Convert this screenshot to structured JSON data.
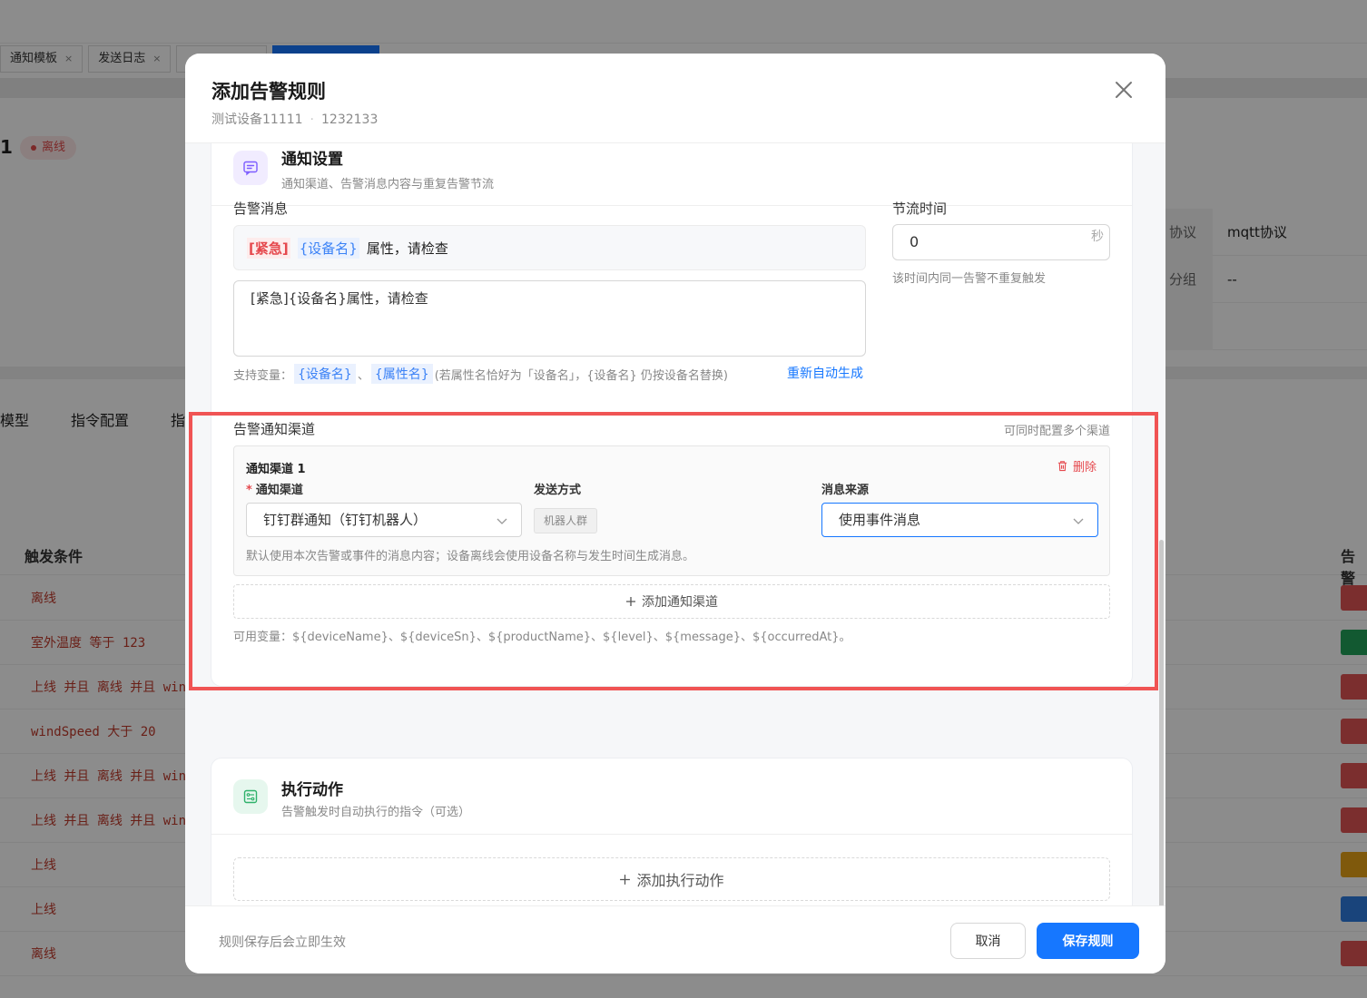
{
  "background": {
    "tabs": [
      {
        "label": "通知模板"
      },
      {
        "label": "发送日志"
      },
      {
        "label": ""
      },
      {
        "label": ""
      }
    ],
    "device_title": "1",
    "status": "离线",
    "info": [
      {
        "key": "协议",
        "value": "mqtt协议"
      },
      {
        "key": "分组",
        "value": "--"
      }
    ],
    "subtabs": [
      "模型",
      "指令配置",
      "指"
    ],
    "table": {
      "col_condition": "触发条件",
      "col_level": "告警",
      "rows": [
        {
          "condition": "离线",
          "level_color": "#e05555"
        },
        {
          "condition": "室外温度 等于 123",
          "level_color": "#22a35a"
        },
        {
          "condition": "上线 并且 离线 并且 wind",
          "level_color": "#e05555"
        },
        {
          "condition": "windSpeed 大于 20",
          "level_color": "#e05555"
        },
        {
          "condition": "上线 并且 离线 并且 wind",
          "level_color": "#e05555"
        },
        {
          "condition": "上线 并且 离线 并且 wind",
          "level_color": "#e05555"
        },
        {
          "condition": "上线",
          "level_color": "#e8a317"
        },
        {
          "condition": "上线",
          "level_color": "#2f7de1"
        },
        {
          "condition": "离线",
          "level_color": "#e05555"
        }
      ]
    }
  },
  "modal": {
    "title": "添加告警规则",
    "device_name": "测试设备11111",
    "device_sn": "1232133",
    "close_icon": "close-icon",
    "notify": {
      "title": "通知设置",
      "desc": "通知渠道、告警消息内容与重复告警节流",
      "icon": "message-icon",
      "message_label": "告警消息",
      "preview": {
        "urgent": "[紧急]",
        "var": "{设备名}",
        "rest": "属性，请检查"
      },
      "message_value": "[紧急]{设备名}属性，请检查",
      "vars_prefix": "支持变量：",
      "var_device": "{设备名}",
      "var_sep": "、",
      "var_attr": "{属性名}",
      "vars_note": "(若属性名恰好为「设备名」，{设备名} 仍按设备名替换)",
      "regen_link": "重新自动生成",
      "throttle_label": "节流时间",
      "throttle_value": "0",
      "throttle_unit": "秒",
      "throttle_help": "该时间内同一告警不重复触发",
      "channels_label": "告警通知渠道",
      "channels_hint": "可同时配置多个渠道",
      "channel": {
        "title": "通知渠道 1",
        "delete_label": "删除",
        "channel_label": "通知渠道",
        "channel_value": "钉钉群通知（钉钉机器人）",
        "method_label": "发送方式",
        "method_value": "机器人群",
        "source_label": "消息来源",
        "source_value": "使用事件消息",
        "help": "默认使用本次告警或事件的消息内容；设备离线会使用设备名称与发生时间生成消息。"
      },
      "add_channel_label": "添加通知渠道",
      "available_vars": "可用变量：${deviceName}、${deviceSn}、${productName}、${level}、${message}、${occurredAt}。"
    },
    "action": {
      "title": "执行动作",
      "desc": "告警触发时自动执行的指令（可选）",
      "icon": "action-icon",
      "add_label": "添加执行动作"
    },
    "footer": {
      "note": "规则保存后会立即生效",
      "cancel_label": "取消",
      "save_label": "保存规则"
    }
  }
}
